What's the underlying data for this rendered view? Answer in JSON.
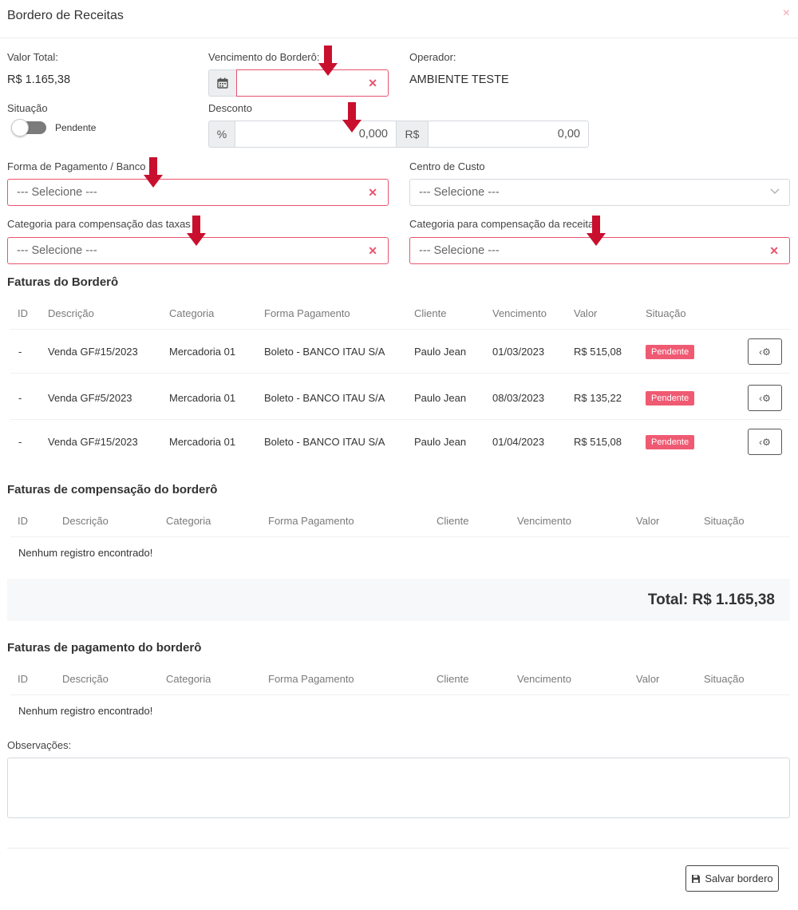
{
  "modal": {
    "title": "Bordero de Receitas",
    "close_glyph": "×"
  },
  "summary": {
    "valor_total_label": "Valor Total:",
    "valor_total": "R$ 1.165,38",
    "vencimento_label": "Vencimento do Borderô:",
    "vencimento_value": "",
    "operador_label": "Operador:",
    "operador": "AMBIENTE TESTE",
    "situacao_label": "Situação",
    "situacao_value": "Pendente",
    "desconto_label": "Desconto",
    "desconto_pct_addon": "%",
    "desconto_pct": "0,000",
    "desconto_rs_addon": "R$",
    "desconto_rs": "0,00"
  },
  "fields": {
    "forma_label": "Forma de Pagamento / Banco",
    "forma_placeholder": "--- Selecione ---",
    "centro_label": "Centro de Custo",
    "centro_placeholder": "--- Selecione ---",
    "cat_taxas_label": "Categoria para compensação das taxas",
    "cat_taxas_placeholder": "--- Selecione ---",
    "cat_receita_label": "Categoria para compensação da receita",
    "cat_receita_placeholder": "--- Selecione ---"
  },
  "faturas": {
    "title": "Faturas do Borderô",
    "headers": [
      "ID",
      "Descrição",
      "Categoria",
      "Forma Pagamento",
      "Cliente",
      "Vencimento",
      "Valor",
      "Situação"
    ],
    "rows": [
      {
        "id": "-",
        "descricao": "Venda GF#15/2023",
        "categoria": "Mercadoria 01",
        "forma": "Boleto - BANCO ITAU S/A",
        "cliente": "Paulo Jean",
        "vencimento": "01/03/2023",
        "valor": "R$ 515,08",
        "situacao": "Pendente"
      },
      {
        "id": "-",
        "descricao": "Venda GF#5/2023",
        "categoria": "Mercadoria 01",
        "forma": "Boleto - BANCO ITAU S/A",
        "cliente": "Paulo Jean",
        "vencimento": "08/03/2023",
        "valor": "R$ 135,22",
        "situacao": "Pendente"
      },
      {
        "id": "-",
        "descricao": "Venda GF#15/2023",
        "categoria": "Mercadoria 01",
        "forma": "Boleto - BANCO ITAU S/A",
        "cliente": "Paulo Jean",
        "vencimento": "01/04/2023",
        "valor": "R$ 515,08",
        "situacao": "Pendente"
      }
    ]
  },
  "compensacao": {
    "title": "Faturas de compensação do borderô",
    "headers": [
      "ID",
      "Descrição",
      "Categoria",
      "Forma Pagamento",
      "Cliente",
      "Vencimento",
      "Valor",
      "Situação"
    ],
    "empty": "Nenhum registro encontrado!",
    "total": "Total: R$ 1.165,38"
  },
  "pagamento": {
    "title": "Faturas de pagamento do borderô",
    "headers": [
      "ID",
      "Descrição",
      "Categoria",
      "Forma Pagamento",
      "Cliente",
      "Vencimento",
      "Valor",
      "Situação"
    ],
    "empty": "Nenhum registro encontrado!"
  },
  "observacoes": {
    "label": "Observações:",
    "value": ""
  },
  "actions": {
    "save_label": "Salvar bordero"
  },
  "icons": {
    "calendar": "calendar-icon",
    "clear": "clear-x-icon",
    "chevron": "chevron-down-icon",
    "gear": "gear-icon",
    "save": "floppy-disk-icon",
    "arrow": "red-down-arrow-annotation"
  },
  "colors": {
    "error_border": "#e8546f",
    "badge": "#ef5a72",
    "annotation_arrow": "#c8102e"
  }
}
